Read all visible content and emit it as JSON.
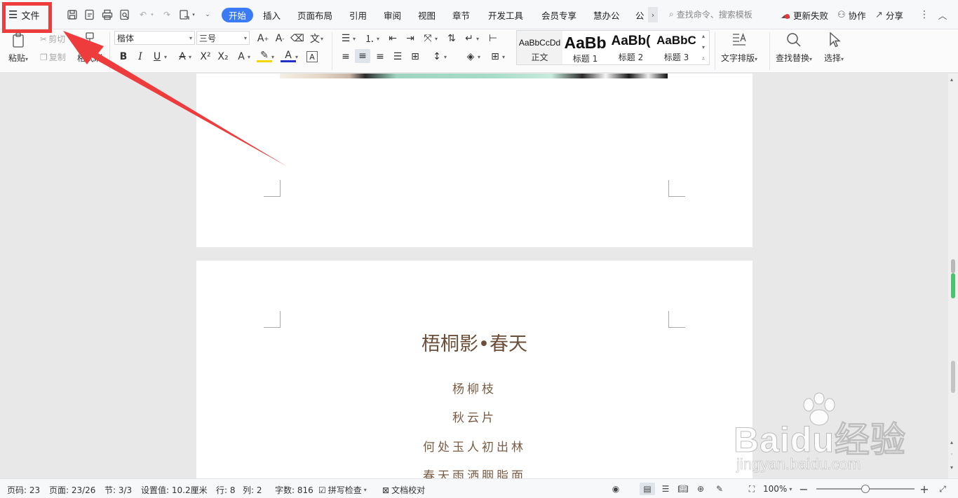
{
  "titlebar": {
    "file_menu_label": "文件",
    "tabs": [
      "开始",
      "插入",
      "页面布局",
      "引用",
      "审阅",
      "视图",
      "章节",
      "开发工具",
      "会员专享",
      "慧办公",
      "公"
    ],
    "search_placeholder": "查找命令、搜索模板",
    "update_status": "更新失败",
    "collaborate_label": "协作",
    "share_label": "分享"
  },
  "ribbon": {
    "clipboard": {
      "paste": "粘贴",
      "cut": "剪切",
      "copy": "复制",
      "format_painter": "格式刷"
    },
    "font": {
      "name": "楷体",
      "size": "三号"
    },
    "styles": [
      {
        "preview": "AaBbCcDd",
        "label": "正文"
      },
      {
        "preview": "AaBb",
        "label": "标题 1"
      },
      {
        "preview": "AaBb(",
        "label": "标题 2"
      },
      {
        "preview": "AaBbC",
        "label": "标题 3"
      }
    ],
    "text_layout": "文字排版",
    "find_replace": "查找替换",
    "select": "选择"
  },
  "document": {
    "title": "梧桐影•春天",
    "lines": [
      "杨柳枝",
      "秋云片",
      "何处玉人初出林",
      "春天雨洒胭脂面"
    ]
  },
  "statusbar": {
    "page_number": "页码: 23",
    "page_of": "页面: 23/26",
    "section": "节: 3/3",
    "setting": "设置值: 10.2厘米",
    "row": "行: 8",
    "column": "列: 2",
    "word_count": "字数: 816",
    "spell_check": "拼写检查",
    "doc_proof": "文档校对",
    "zoom": "100%",
    "zoom_level_fraction": 0.5
  },
  "watermark": {
    "main": "Baidu经验",
    "sub": "jingyan.baidu.com"
  },
  "colors": {
    "accent": "#3b7cf6",
    "annotation": "#ee3b3b",
    "title_text": "#6b4f3a"
  }
}
